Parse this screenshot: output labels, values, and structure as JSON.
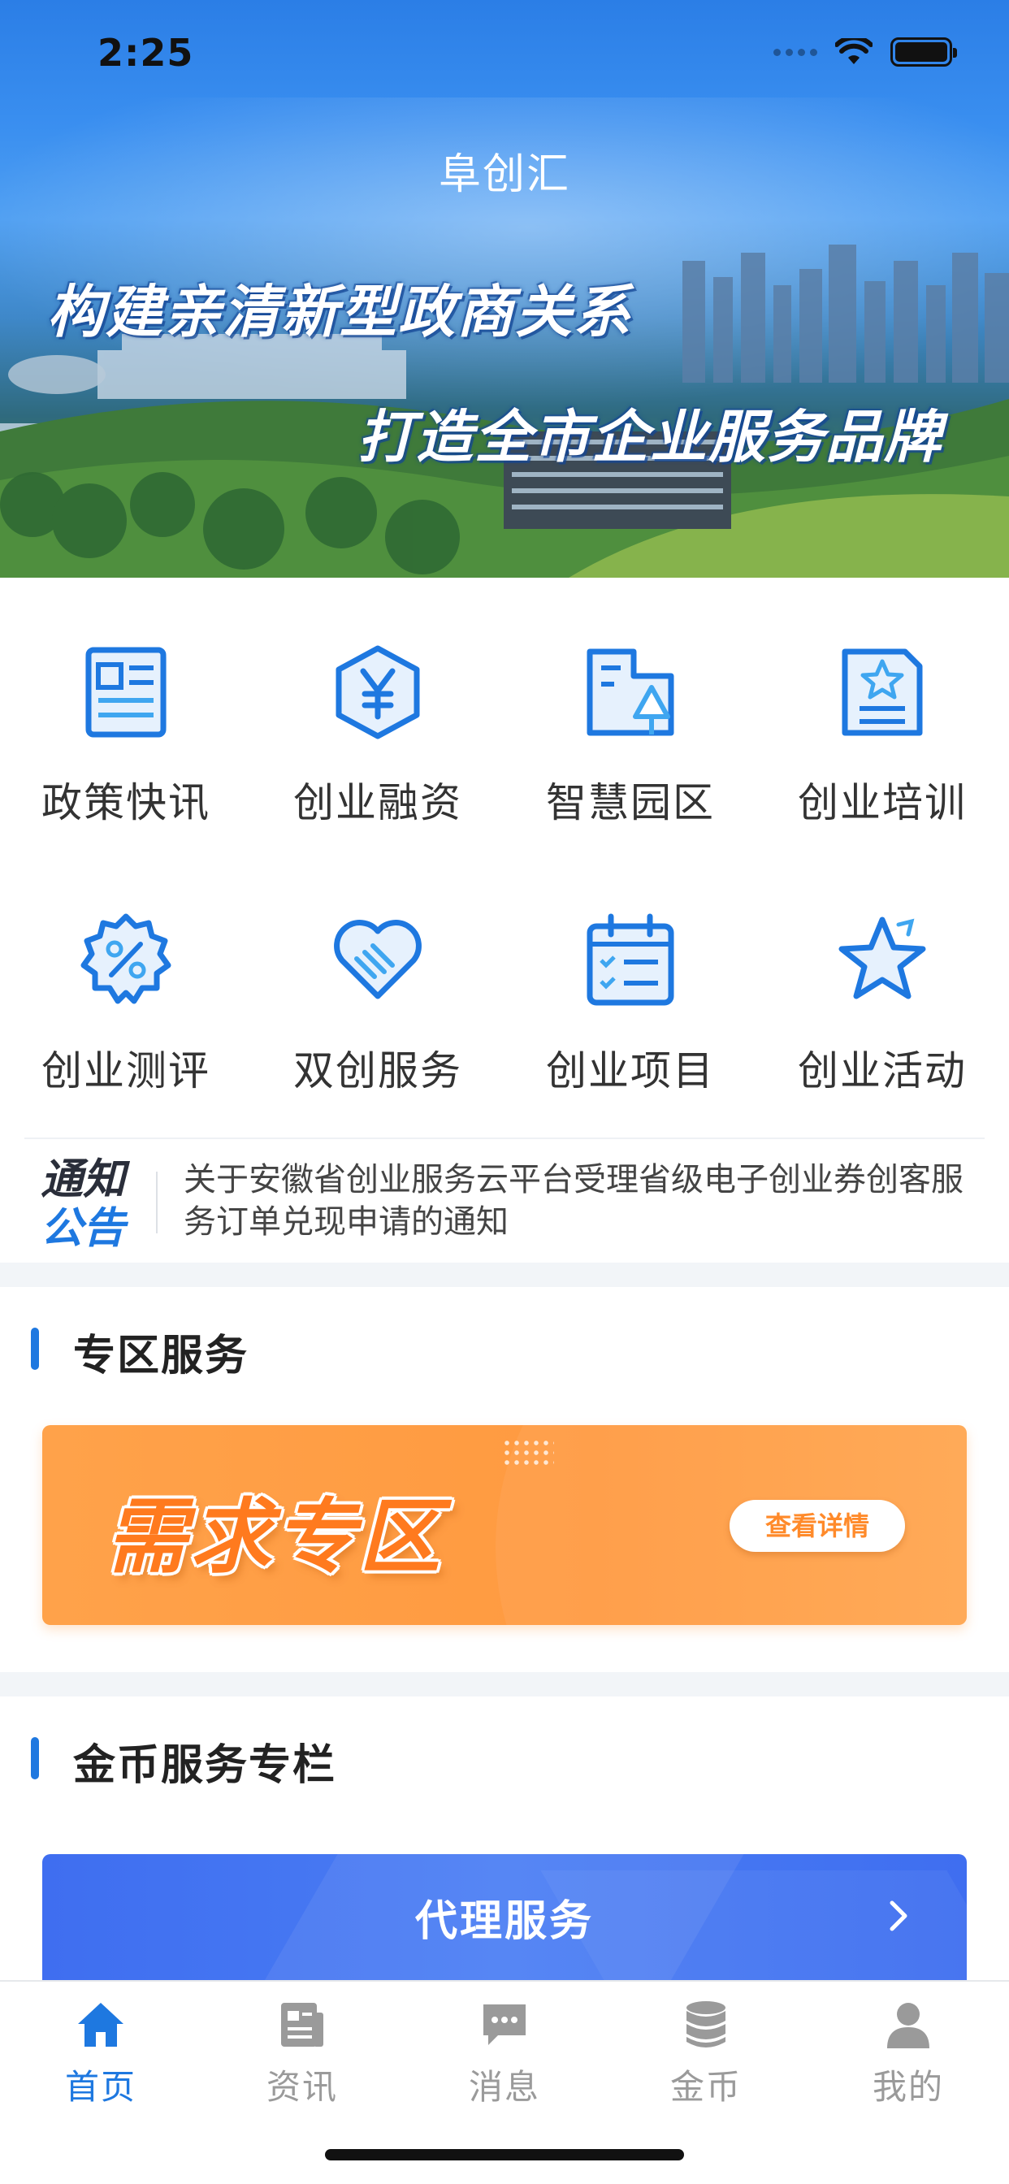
{
  "status_bar": {
    "time": "2:25"
  },
  "header": {
    "app_title": "阜创汇"
  },
  "banner": {
    "slogan_line1": "构建亲清新型政商关系",
    "slogan_line2": "打造全市企业服务品牌"
  },
  "quick_grid": [
    {
      "label": "政策快讯",
      "icon": "news-document-icon"
    },
    {
      "label": "创业融资",
      "icon": "yuan-hexagon-icon"
    },
    {
      "label": "智慧园区",
      "icon": "park-building-tree-icon"
    },
    {
      "label": "创业培训",
      "icon": "training-certificate-star-icon"
    },
    {
      "label": "创业测评",
      "icon": "percent-badge-icon"
    },
    {
      "label": "双创服务",
      "icon": "handshake-heart-icon"
    },
    {
      "label": "创业项目",
      "icon": "calendar-checklist-icon"
    },
    {
      "label": "创业活动",
      "icon": "star-icon"
    }
  ],
  "notice": {
    "tag_line1": "通知",
    "tag_line2": "公告",
    "text": "关于安徽省创业服务云平台受理省级电子创业券创客服务订单兑现申请的通知"
  },
  "zone_section": {
    "title": "专区服务",
    "card_title": "需求专区",
    "card_button": "查看详情"
  },
  "coin_section": {
    "title": "金币服务专栏",
    "card_label": "代理服务"
  },
  "tabbar": [
    {
      "label": "首页",
      "icon": "home-icon",
      "active": true
    },
    {
      "label": "资讯",
      "icon": "news-icon",
      "active": false
    },
    {
      "label": "消息",
      "icon": "message-icon",
      "active": false
    },
    {
      "label": "金币",
      "icon": "coins-stack-icon",
      "active": false
    },
    {
      "label": "我的",
      "icon": "profile-icon",
      "active": false
    }
  ],
  "colors": {
    "primary": "#1e78e0",
    "orange": "#ff9a40",
    "agent_blue": "#4577f2",
    "inactive": "#9a9a9a"
  }
}
